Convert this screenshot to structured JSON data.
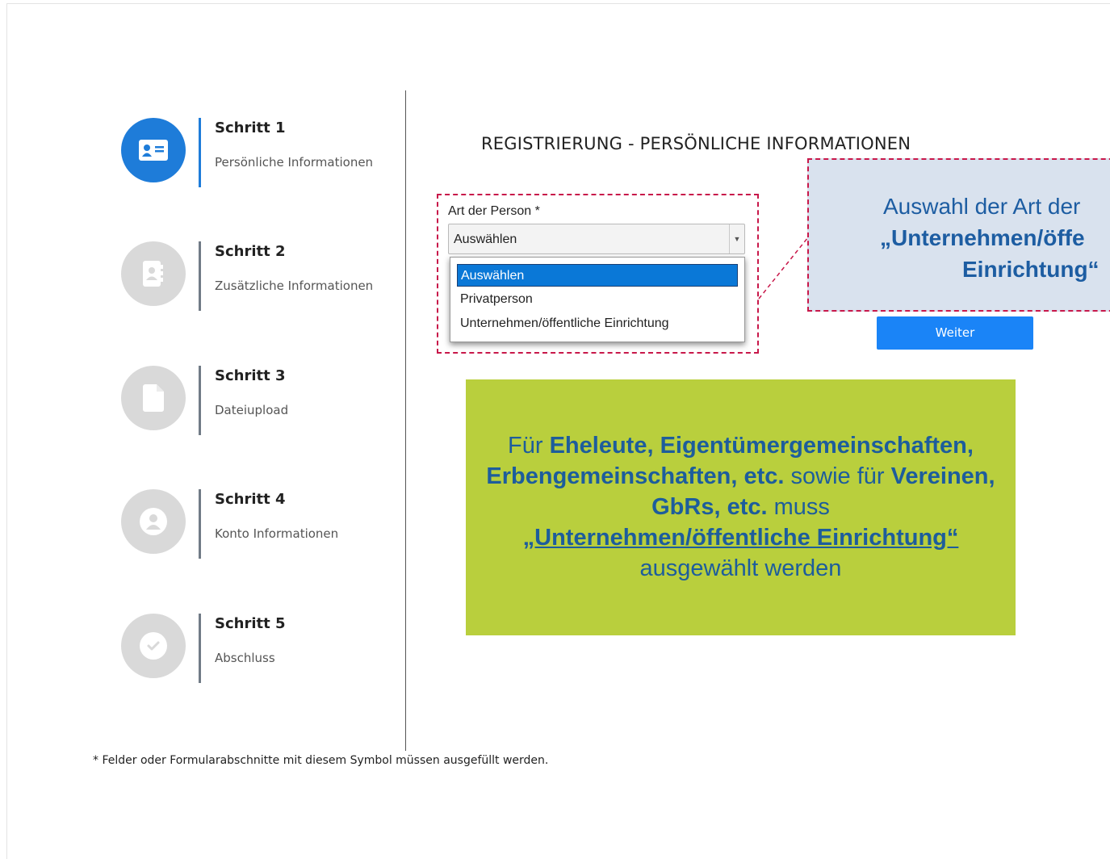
{
  "steps": [
    {
      "title": "Schritt 1",
      "subtitle": "Persönliche Informationen",
      "icon": "id-card-icon",
      "active": true
    },
    {
      "title": "Schritt 2",
      "subtitle": "Zusätzliche Informationen",
      "icon": "address-book-icon",
      "active": false
    },
    {
      "title": "Schritt 3",
      "subtitle": "Dateiupload",
      "icon": "file-icon",
      "active": false
    },
    {
      "title": "Schritt 4",
      "subtitle": "Konto Informationen",
      "icon": "user-circle-icon",
      "active": false
    },
    {
      "title": "Schritt 5",
      "subtitle": "Abschluss",
      "icon": "check-circle-icon",
      "active": false
    }
  ],
  "form": {
    "heading": "REGISTRIERUNG - PERSÖNLICHE INFORMATIONEN",
    "person_type_label": "Art der Person *",
    "select_value": "Auswählen",
    "options": [
      "Auswählen",
      "Privatperson",
      "Unternehmen/öffentliche Einrichtung"
    ],
    "next_button": "Weiter"
  },
  "callout_blue": {
    "line1": "Auswahl der Art der",
    "line2": "„Unternehmen/öffe",
    "line3": "Einrichtung“"
  },
  "callout_green": {
    "prefix": "Für ",
    "bold1": "Eheleute, Eigentümergemeinschaften, Erbengemeinschaften, etc.",
    "mid1": " sowie für ",
    "bold2": "Vereinen, GbRs, etc.",
    "mid2": " muss ",
    "underlined": "„Unternehmen/öffentliche Einrichtung“",
    "suffix": "ausgewählt werden"
  },
  "footnote": "* Felder oder Formularabschnitte mit diesem Symbol müssen ausgefüllt werden.",
  "colors": {
    "accent": "#1e7cd9",
    "button": "#1a84f7",
    "highlight_border": "#c8184a",
    "green_callout": "#b9cf3d",
    "blue_callout": "#d9e2ee"
  }
}
